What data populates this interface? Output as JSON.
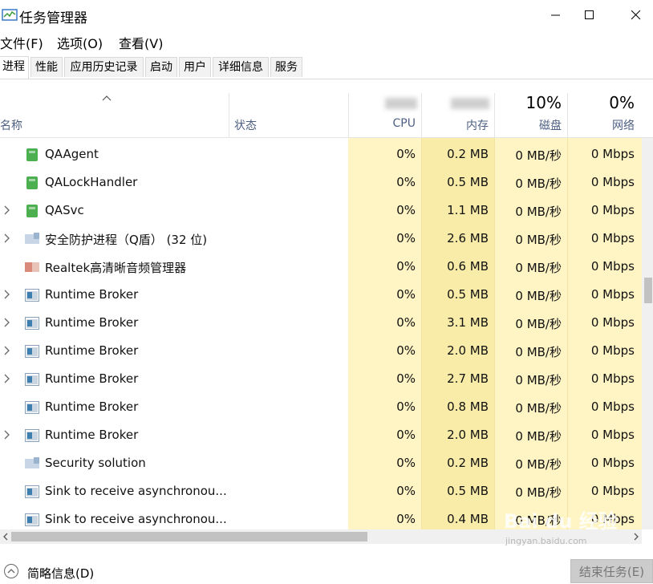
{
  "window": {
    "title": "任务管理器",
    "controls": [
      "minimize-icon",
      "maximize-icon",
      "close-icon"
    ]
  },
  "menu": [
    "文件(F)",
    "选项(O)",
    "查看(V)"
  ],
  "tabs": [
    "进程",
    "性能",
    "应用历史记录",
    "启动",
    "用户",
    "详细信息",
    "服务"
  ],
  "header": {
    "name_label": "名称",
    "status_label": "状态",
    "cpu_label": "CPU",
    "memory_label": "内存",
    "disk_pct": "10%",
    "disk_label": "磁盘",
    "network_pct": "0%",
    "network_label": "网络"
  },
  "rows": [
    {
      "name": "QAAgent",
      "cpu": "0%",
      "mem": "0.2 MB",
      "disk": "0 MB/秒",
      "net": "0 Mbps",
      "expandable": false,
      "icon": "green-app-icon"
    },
    {
      "name": "QALockHandler",
      "cpu": "0%",
      "mem": "0.5 MB",
      "disk": "0 MB/秒",
      "net": "0 Mbps",
      "expandable": false,
      "icon": "green-app-icon"
    },
    {
      "name": "QASvc",
      "cpu": "0%",
      "mem": "1.1 MB",
      "disk": "0 MB/秒",
      "net": "0 Mbps",
      "expandable": true,
      "icon": "green-app-icon"
    },
    {
      "name": "安全防护进程（Q盾） (32 位)",
      "cpu": "0%",
      "mem": "2.6 MB",
      "disk": "0 MB/秒",
      "net": "0 Mbps",
      "expandable": true,
      "icon": "shield-app-icon"
    },
    {
      "name": "Realtek高清晰音频管理器",
      "cpu": "0%",
      "mem": "0.6 MB",
      "disk": "0 MB/秒",
      "net": "0 Mbps",
      "expandable": false,
      "icon": "speaker-app-icon"
    },
    {
      "name": "Runtime Broker",
      "cpu": "0%",
      "mem": "0.5 MB",
      "disk": "0 MB/秒",
      "net": "0 Mbps",
      "expandable": true,
      "icon": "window-app-icon"
    },
    {
      "name": "Runtime Broker",
      "cpu": "0%",
      "mem": "3.1 MB",
      "disk": "0 MB/秒",
      "net": "0 Mbps",
      "expandable": true,
      "icon": "window-app-icon"
    },
    {
      "name": "Runtime Broker",
      "cpu": "0%",
      "mem": "2.0 MB",
      "disk": "0 MB/秒",
      "net": "0 Mbps",
      "expandable": true,
      "icon": "window-app-icon"
    },
    {
      "name": "Runtime Broker",
      "cpu": "0%",
      "mem": "2.7 MB",
      "disk": "0 MB/秒",
      "net": "0 Mbps",
      "expandable": true,
      "icon": "window-app-icon"
    },
    {
      "name": "Runtime Broker",
      "cpu": "0%",
      "mem": "0.8 MB",
      "disk": "0 MB/秒",
      "net": "0 Mbps",
      "expandable": false,
      "icon": "window-app-icon"
    },
    {
      "name": "Runtime Broker",
      "cpu": "0%",
      "mem": "2.0 MB",
      "disk": "0 MB/秒",
      "net": "0 Mbps",
      "expandable": true,
      "icon": "window-app-icon"
    },
    {
      "name": "Security solution",
      "cpu": "0%",
      "mem": "0.2 MB",
      "disk": "0 MB/秒",
      "net": "0 Mbps",
      "expandable": false,
      "icon": "shield-app-icon"
    },
    {
      "name": "Sink to receive asynchronou...",
      "cpu": "0%",
      "mem": "0.5 MB",
      "disk": "0 MB/秒",
      "net": "0 Mbps",
      "expandable": false,
      "icon": "window-app-icon"
    },
    {
      "name": "Sink to receive asynchronou...",
      "cpu": "0%",
      "mem": "0.4 MB",
      "disk": "0 MB/秒",
      "net": "0 Mbps",
      "expandable": false,
      "icon": "window-app-icon"
    }
  ],
  "footer": {
    "fewer_details": "简略信息(D)",
    "end_task": "结束任务(E)"
  },
  "watermark": {
    "brand": "Bai du 经验",
    "url": "jingyan.baidu.com"
  },
  "colors": {
    "cpu_column_bg": "#fff4c4",
    "memory_column_bg": "#f9eca8",
    "disk_column_bg": "#fff4c4",
    "network_column_bg": "#fff4c4",
    "header_label": "#4d6082"
  }
}
